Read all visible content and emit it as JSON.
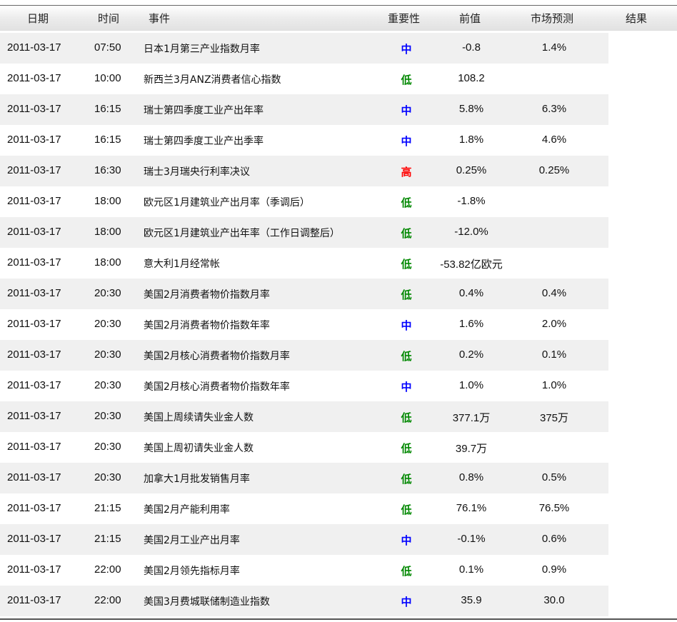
{
  "headers": {
    "date": "日期",
    "time": "时间",
    "event": "事件",
    "importance": "重要性",
    "previous": "前值",
    "forecast": "市场预测",
    "result": "结果"
  },
  "importance_colors": {
    "高": "#ff0000",
    "中": "#0000ff",
    "低": "#008800"
  },
  "rows": [
    {
      "date": "2011-03-17",
      "time": "07:50",
      "event": "日本1月第三产业指数月率",
      "importance": "中",
      "previous": "-0.8",
      "forecast": "1.4%",
      "result": ""
    },
    {
      "date": "2011-03-17",
      "time": "10:00",
      "event": "新西兰3月ANZ消费者信心指数",
      "importance": "低",
      "previous": "108.2",
      "forecast": "",
      "result": ""
    },
    {
      "date": "2011-03-17",
      "time": "16:15",
      "event": "瑞士第四季度工业产出年率",
      "importance": "中",
      "previous": "5.8%",
      "forecast": "6.3%",
      "result": ""
    },
    {
      "date": "2011-03-17",
      "time": "16:15",
      "event": "瑞士第四季度工业产出季率",
      "importance": "中",
      "previous": "1.8%",
      "forecast": "4.6%",
      "result": ""
    },
    {
      "date": "2011-03-17",
      "time": "16:30",
      "event": "瑞士3月瑞央行利率决议",
      "importance": "高",
      "previous": "0.25%",
      "forecast": "0.25%",
      "result": ""
    },
    {
      "date": "2011-03-17",
      "time": "18:00",
      "event": "欧元区1月建筑业产出月率（季调后）",
      "importance": "低",
      "previous": "-1.8%",
      "forecast": "",
      "result": ""
    },
    {
      "date": "2011-03-17",
      "time": "18:00",
      "event": "欧元区1月建筑业产出年率（工作日调整后）",
      "importance": "低",
      "previous": "-12.0%",
      "forecast": "",
      "result": ""
    },
    {
      "date": "2011-03-17",
      "time": "18:00",
      "event": "意大利1月经常帐",
      "importance": "低",
      "previous": "-53.82亿欧元",
      "forecast": "",
      "result": ""
    },
    {
      "date": "2011-03-17",
      "time": "20:30",
      "event": "美国2月消费者物价指数月率",
      "importance": "低",
      "previous": "0.4%",
      "forecast": "0.4%",
      "result": ""
    },
    {
      "date": "2011-03-17",
      "time": "20:30",
      "event": "美国2月消费者物价指数年率",
      "importance": "中",
      "previous": "1.6%",
      "forecast": "2.0%",
      "result": ""
    },
    {
      "date": "2011-03-17",
      "time": "20:30",
      "event": "美国2月核心消费者物价指数月率",
      "importance": "低",
      "previous": "0.2%",
      "forecast": "0.1%",
      "result": ""
    },
    {
      "date": "2011-03-17",
      "time": "20:30",
      "event": "美国2月核心消费者物价指数年率",
      "importance": "中",
      "previous": "1.0%",
      "forecast": "1.0%",
      "result": ""
    },
    {
      "date": "2011-03-17",
      "time": "20:30",
      "event": "美国上周续请失业金人数",
      "importance": "低",
      "previous": "377.1万",
      "forecast": "375万",
      "result": ""
    },
    {
      "date": "2011-03-17",
      "time": "20:30",
      "event": "美国上周初请失业金人数",
      "importance": "低",
      "previous": "39.7万",
      "forecast": "",
      "result": ""
    },
    {
      "date": "2011-03-17",
      "time": "20:30",
      "event": "加拿大1月批发销售月率",
      "importance": "低",
      "previous": "0.8%",
      "forecast": "0.5%",
      "result": ""
    },
    {
      "date": "2011-03-17",
      "time": "21:15",
      "event": "美国2月产能利用率",
      "importance": "低",
      "previous": "76.1%",
      "forecast": "76.5%",
      "result": ""
    },
    {
      "date": "2011-03-17",
      "time": "21:15",
      "event": "美国2月工业产出月率",
      "importance": "中",
      "previous": "-0.1%",
      "forecast": "0.6%",
      "result": ""
    },
    {
      "date": "2011-03-17",
      "time": "22:00",
      "event": "美国2月领先指标月率",
      "importance": "低",
      "previous": "0.1%",
      "forecast": "0.9%",
      "result": ""
    },
    {
      "date": "2011-03-17",
      "time": "22:00",
      "event": "美国3月费城联储制造业指数",
      "importance": "中",
      "previous": "35.9",
      "forecast": "30.0",
      "result": ""
    }
  ]
}
